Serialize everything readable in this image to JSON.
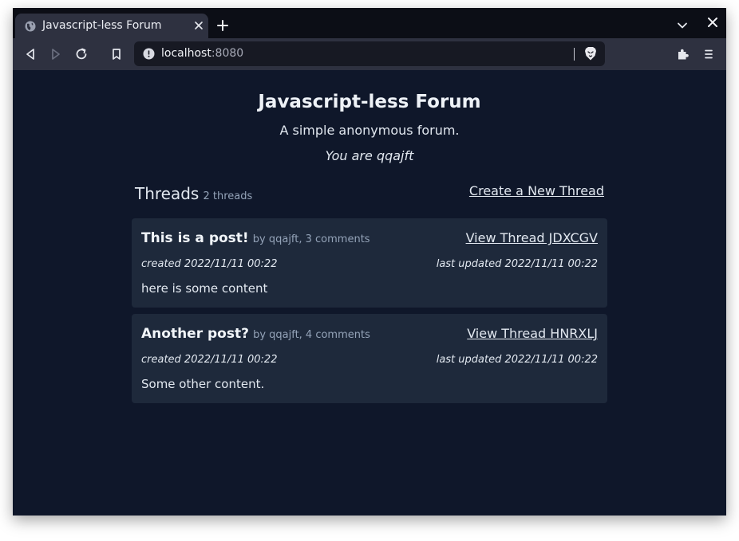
{
  "browser": {
    "tab_title": "Javascript-less Forum",
    "url_host": "localhost",
    "url_port": ":8080"
  },
  "site": {
    "title": "Javascript-less Forum",
    "subtitle": "A simple anonymous forum.",
    "user_line": "You are qqajft"
  },
  "threads": {
    "heading": "Threads",
    "count_label": "2 threads",
    "create_link": "Create a New Thread",
    "items": [
      {
        "title": "This is a post!",
        "meta": "by qqajft, 3 comments",
        "view_link": "View Thread JDXCGV",
        "created": "created 2022/11/11 00:22",
        "updated": "last updated 2022/11/11 00:22",
        "content": "here is some content"
      },
      {
        "title": "Another post?",
        "meta": "by qqajft, 4 comments",
        "view_link": "View Thread HNRXLJ",
        "created": "created 2022/11/11 00:22",
        "updated": "last updated 2022/11/11 00:22",
        "content": "Some other content."
      }
    ]
  },
  "icons": {
    "tab_favicon": "globe-icon",
    "tab_close": "close-icon",
    "new_tab": "plus-icon",
    "tab_search": "chevron-down-icon",
    "window_close": "close-icon",
    "back": "back-icon",
    "forward": "forward-icon",
    "reload": "reload-icon",
    "bookmark": "bookmark-icon",
    "site_info": "info-icon",
    "brave_shields": "brave-lion-icon",
    "extensions": "puzzle-icon",
    "menu": "menu-icon"
  },
  "colors": {
    "page_bg": "#0f172a",
    "card_bg": "#1e293b",
    "muted_text": "#94a3b8",
    "text": "#e2e8f0"
  }
}
